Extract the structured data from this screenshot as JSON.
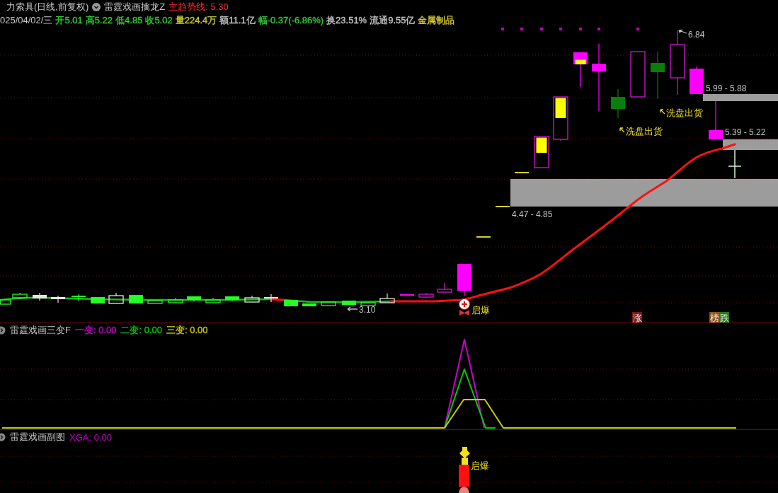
{
  "header": {
    "stock": "力索具(日线,前复权)",
    "indicator": "雷霆戏画擒龙Z",
    "trend": "主趋势线: 5.30"
  },
  "quote": {
    "date": "025/04/02/三",
    "fields": [
      {
        "text": "开5.01",
        "color": "#33cc33"
      },
      {
        "text": "高5.22",
        "color": "#33cc33"
      },
      {
        "text": "低4.85",
        "color": "#33cc33"
      },
      {
        "text": "收5.02",
        "color": "#33cc33"
      },
      {
        "text": "量224.4万",
        "color": "#cccc33"
      },
      {
        "text": "额11.1亿",
        "color": "#c8c8c8"
      },
      {
        "text": "幅-0.37(-6.86%)",
        "color": "#33cc33"
      },
      {
        "text": "换23.51%",
        "color": "#c8c8c8"
      },
      {
        "text": "流通9.55亿",
        "color": "#c8c8c8"
      },
      {
        "text": "金属制品",
        "color": "#e0d030"
      }
    ]
  },
  "main_chart": {
    "high": {
      "text": "6.84"
    },
    "zones": [
      {
        "label": "5.99 - 5.88"
      },
      {
        "label": "5.39 - 5.22"
      },
      {
        "label": "4.47 - 4.85"
      }
    ],
    "notes": [
      {
        "text": "洗盘出货"
      },
      {
        "text": "洗盘出货"
      }
    ],
    "low": {
      "text": "3.10"
    },
    "signal": {
      "text": "启爆"
    },
    "tags": [
      {
        "text": "涨",
        "color": "#7a1414"
      },
      {
        "text": "榜",
        "color": "#8a5418"
      },
      {
        "text": "跌",
        "color": "#1a7a1a"
      }
    ]
  },
  "panel_change": {
    "title": "雷霆戏画三变F",
    "readings": [
      {
        "text": "一变: 0.00",
        "color": "#cc00cc"
      },
      {
        "text": "二变: 0.00",
        "color": "#00cc00"
      },
      {
        "text": "三变: 0.00",
        "color": "#cccc00"
      }
    ]
  },
  "panel_sub": {
    "title": "雷霆戏画副图",
    "reading": "XGA: 0.00",
    "signal": {
      "text": "启爆"
    }
  }
}
